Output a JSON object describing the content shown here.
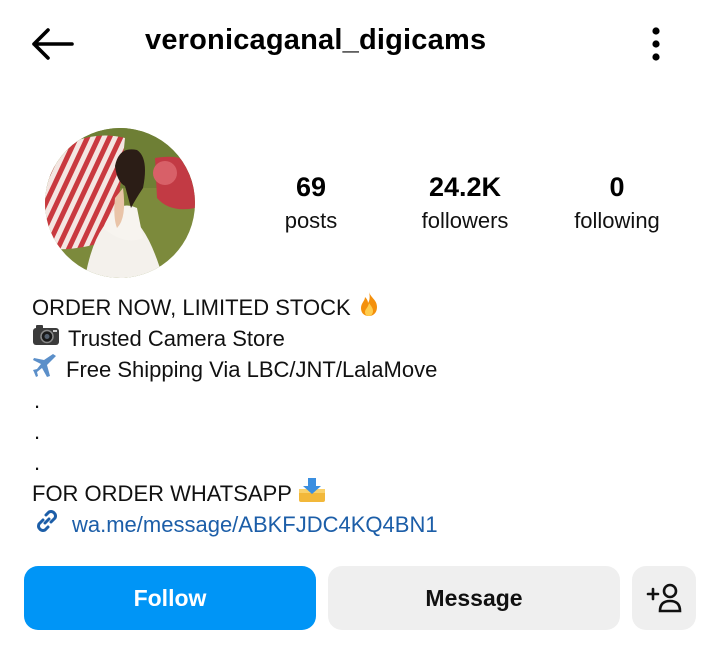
{
  "header": {
    "username": "veronicaganal_digicams"
  },
  "stats": {
    "posts": {
      "value": "69",
      "label": "posts"
    },
    "followers": {
      "value": "24.2K",
      "label": "followers"
    },
    "following": {
      "value": "0",
      "label": "following"
    }
  },
  "bio": {
    "line1": "ORDER NOW, LIMITED STOCK",
    "line2": "Trusted Camera Store",
    "line3": "Free Shipping Via LBC/JNT/LalaMove",
    "dot1": ".",
    "dot2": ".",
    "dot3": ".",
    "line4": "FOR ORDER WHATSAPP",
    "link": "wa.me/message/ABKFJDC4KQ4BN1"
  },
  "buttons": {
    "follow": "Follow",
    "message": "Message"
  },
  "icons": {
    "back": "back-arrow-icon",
    "more": "more-vertical-icon",
    "fire": "fire-emoji-icon",
    "camera": "camera-emoji-icon",
    "airplane": "airplane-emoji-icon",
    "inbox": "inbox-tray-emoji-icon",
    "link": "link-icon",
    "add_user": "add-user-icon"
  },
  "colors": {
    "follow_button": "#0095f6",
    "secondary_button": "#efefef",
    "link_text": "#1c5ea8"
  }
}
